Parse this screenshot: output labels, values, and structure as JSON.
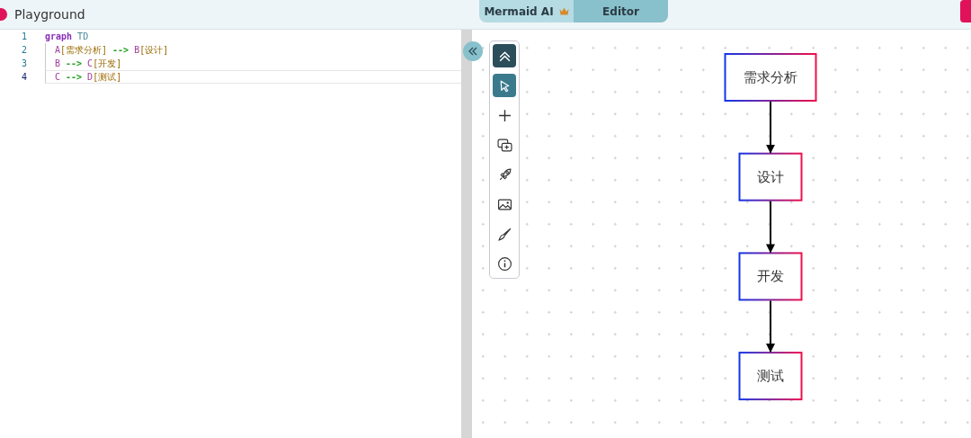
{
  "header": {
    "title": "Playground",
    "mode_toggle": [
      {
        "label": "Mermaid AI",
        "selected": false,
        "crown": true
      },
      {
        "label": "Editor",
        "selected": true,
        "crown": false
      }
    ]
  },
  "editor": {
    "lines": [
      {
        "number": "1",
        "active": false,
        "indent": false,
        "tokens": [
          {
            "kind": "keyword",
            "text": "graph"
          },
          {
            "kind": "direction",
            "text": "TD"
          }
        ]
      },
      {
        "number": "2",
        "active": false,
        "indent": true,
        "tokens": [
          {
            "kind": "node",
            "text": "A"
          },
          {
            "kind": "label",
            "text": "[需求分析]"
          },
          {
            "kind": "arrow",
            "text": "-->"
          },
          {
            "kind": "node",
            "text": "B"
          },
          {
            "kind": "label",
            "text": "[设计]"
          }
        ]
      },
      {
        "number": "3",
        "active": false,
        "indent": true,
        "tokens": [
          {
            "kind": "node",
            "text": "B"
          },
          {
            "kind": "arrow",
            "text": "-->"
          },
          {
            "kind": "node",
            "text": "C"
          },
          {
            "kind": "label",
            "text": "[开发]"
          }
        ]
      },
      {
        "number": "4",
        "active": true,
        "indent": true,
        "tokens": [
          {
            "kind": "node",
            "text": "C"
          },
          {
            "kind": "arrow",
            "text": "-->"
          },
          {
            "kind": "node",
            "text": "D"
          },
          {
            "kind": "label",
            "text": "[测试]"
          }
        ]
      }
    ]
  },
  "toolbar": [
    {
      "kind": "collapse",
      "selected": false
    },
    {
      "kind": "pointer",
      "selected": true
    },
    {
      "kind": "plus",
      "selected": false
    },
    {
      "kind": "add-layer",
      "selected": false
    },
    {
      "kind": "rocket",
      "selected": false
    },
    {
      "kind": "image",
      "selected": false
    },
    {
      "kind": "brush",
      "selected": false
    },
    {
      "kind": "info",
      "selected": false
    }
  ],
  "diagram": {
    "nodes": [
      {
        "label": "需求分析"
      },
      {
        "label": "设计"
      },
      {
        "label": "开发"
      },
      {
        "label": "测试"
      }
    ]
  }
}
